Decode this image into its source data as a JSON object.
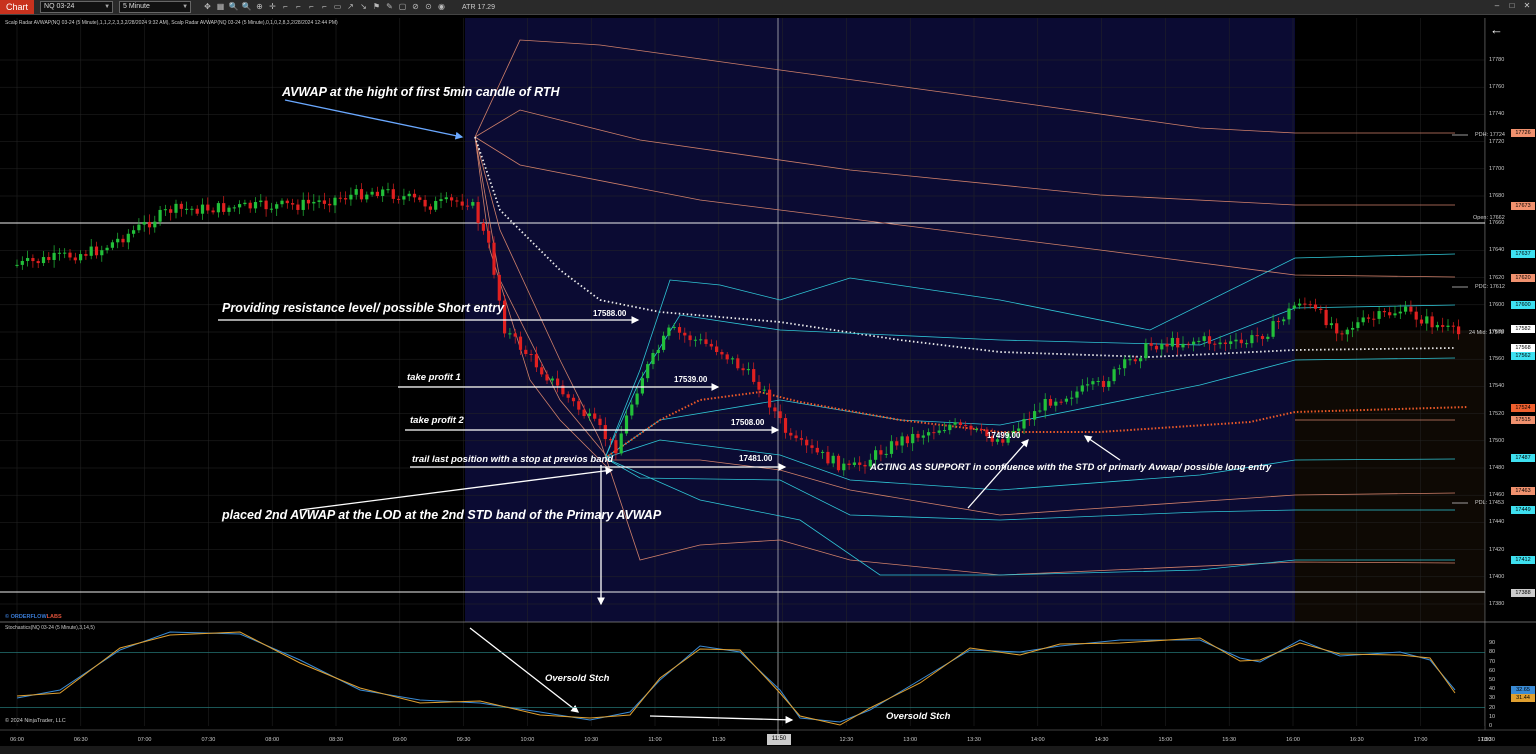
{
  "toolbar": {
    "tab": "Chart",
    "instrument": "NQ 03-24",
    "interval": "5 Minute",
    "atr": "ATR 17.29",
    "tools": [
      "✥",
      "▦",
      "🔍",
      "🔍",
      "⊕",
      "✛",
      "⌐",
      "⌐",
      "⌐",
      "⌐",
      "▭",
      "↗",
      "↘",
      "⚑",
      "✎",
      "▢",
      "⊘",
      "⊙",
      "◉"
    ]
  },
  "window": {
    "min": "–",
    "max": "□",
    "close": "✕"
  },
  "indicator_title": "Scalp Radar AVWAP(NQ 03-24 (5 Minute),1,1,2,2,3,3,2/28/2024 9:32 AM), Scalp Radar AVWAP(NQ 03-24 (5 Minute),0,1,0,2,8,3,2/28/2024 12:44 PM)",
  "stoch_title": "Stochastics(NQ 03-24 (5 Minute),3,14,5)",
  "brand": {
    "main": "© ORDERFLOW",
    "suffix": "LABS"
  },
  "copyright": "© 2024 NinjaTrader, LLC",
  "annotations": {
    "avwap_first": "AVWAP at the hight of first 5min candle  of RTH",
    "resistance": "Providing resistance level/ possible Short entry",
    "tp1": "take profit  1",
    "tp2": "take profit 2",
    "trail": "trail last position with a stop at previos band",
    "second_avwap": "placed 2nd  AVWAP at the LOD at the 2nd STD band of the Primary AVWAP",
    "support": "ACTING AS SUPPORT  in confluence with the STD of primarly Avwap/ possible long entry",
    "oversold1": "Oversold Stch",
    "oversold2": "Oversold Stch"
  },
  "price_notes": {
    "p1": "17588.00",
    "p2": "17539.00",
    "p3": "17508.00",
    "p4": "17481.00",
    "p5": "17499.00"
  },
  "price_axis": [
    "17780",
    "17760",
    "17740",
    "17720",
    "17700",
    "17680",
    "17660",
    "17640",
    "17620",
    "17600",
    "17580",
    "17560",
    "17540",
    "17520",
    "17500",
    "17480",
    "17460",
    "17440",
    "17420",
    "17400",
    "17380"
  ],
  "price_axis_range": [
    17380,
    17780
  ],
  "level_labels": {
    "pdh": "PDH: 17724",
    "open": "Open: 17662",
    "pdc": "PDC: 17612",
    "mid": "24 Mid: 17578",
    "pdl": "PDL: 17453"
  },
  "badges": [
    {
      "text": "17726",
      "price": 17726,
      "color": "#f0916e"
    },
    {
      "text": "17673",
      "price": 17673,
      "color": "#f0916e"
    },
    {
      "text": "17637",
      "price": 17637,
      "color": "#3ee0f0"
    },
    {
      "text": "17620",
      "price": 17620,
      "color": "#f0916e"
    },
    {
      "text": "17600",
      "price": 17600,
      "color": "#3ee0f0"
    },
    {
      "text": "17582",
      "price": 17582,
      "color": "#ffffff"
    },
    {
      "text": "17568",
      "price": 17568,
      "color": "#ffffff"
    },
    {
      "text": "17562",
      "price": 17562,
      "color": "#3ee0f0"
    },
    {
      "text": "17524",
      "price": 17524,
      "color": "#f0602e"
    },
    {
      "text": "17515",
      "price": 17515,
      "color": "#f0916e"
    },
    {
      "text": "17487",
      "price": 17487,
      "color": "#3ee0f0"
    },
    {
      "text": "17463",
      "price": 17463,
      "color": "#f0916e"
    },
    {
      "text": "17449",
      "price": 17449,
      "color": "#3ee0f0"
    },
    {
      "text": "17412",
      "price": 17412,
      "color": "#3ee0f0"
    },
    {
      "text": "17388",
      "price": 17388,
      "color": "#cccccc"
    }
  ],
  "stoch_axis": [
    "90",
    "80",
    "70",
    "60",
    "50",
    "40",
    "30",
    "20",
    "10",
    "0"
  ],
  "stoch_badges": [
    {
      "text": "32.65",
      "color": "#3a8bd5"
    },
    {
      "text": "31.44",
      "color": "#e0a030"
    }
  ],
  "time_axis": [
    "06:00",
    "06:30",
    "07:00",
    "07:30",
    "08:00",
    "08:30",
    "09:00",
    "09:30",
    "10:00",
    "10:30",
    "11:00",
    "11:30",
    "12:00",
    "12:30",
    "13:00",
    "13:30",
    "14:00",
    "14:30",
    "15:00",
    "15:30",
    "16:00",
    "16:30",
    "17:00",
    "17:30",
    "18:30"
  ],
  "time_cursor": "11:50"
}
